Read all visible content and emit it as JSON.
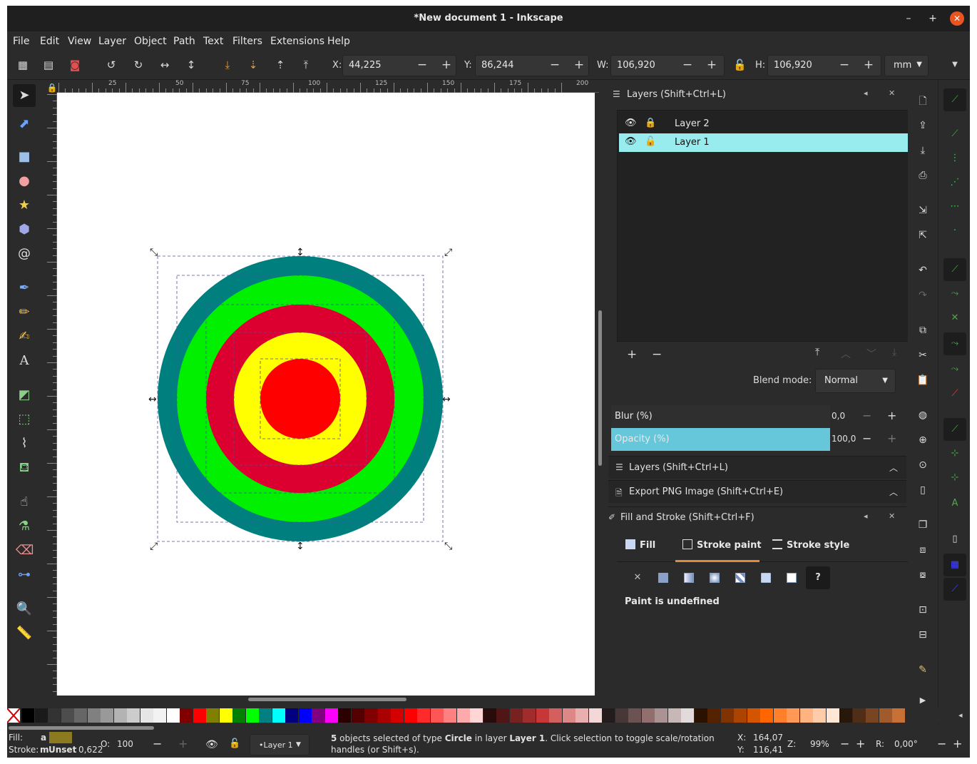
{
  "window": {
    "title": "*New document 1 - Inkscape",
    "min": "–",
    "max": "+",
    "close": "✕"
  },
  "menu": [
    "File",
    "Edit",
    "View",
    "Layer",
    "Object",
    "Path",
    "Text",
    "Filters",
    "Extensions",
    "Help"
  ],
  "toolbar": {
    "x_label": "X:",
    "x_value": "44,225",
    "y_label": "Y:",
    "y_value": "86,244",
    "w_label": "W:",
    "w_value": "106,920",
    "h_label": "H:",
    "h_value": "106,920",
    "unit": "mm"
  },
  "ruler": {
    "top_labels": [
      "25",
      "50",
      "75",
      "100",
      "125",
      "150",
      "175",
      "200"
    ]
  },
  "canvas": {
    "circles": [
      {
        "color": "#007f7f"
      },
      {
        "color": "#00f000"
      },
      {
        "color": "#dc0030"
      },
      {
        "color": "#ffff00"
      },
      {
        "color": "#ff0000"
      }
    ]
  },
  "layers_panel": {
    "title": "Layers (Shift+Ctrl+L)",
    "layers": [
      {
        "name": "Layer 2",
        "selected": false
      },
      {
        "name": "Layer 1",
        "selected": true
      }
    ],
    "blend_label": "Blend mode:",
    "blend_value": "Normal",
    "blur_label": "Blur (%)",
    "blur_value": "0,0",
    "opacity_label": "Opacity (%)",
    "opacity_value": "100,0"
  },
  "collapsed": [
    {
      "title": "Layers (Shift+Ctrl+L)"
    },
    {
      "title": "Export PNG Image (Shift+Ctrl+E)"
    }
  ],
  "fill_stroke": {
    "title": "Fill and Stroke (Shift+Ctrl+F)",
    "tabs": [
      "Fill",
      "Stroke paint",
      "Stroke style"
    ],
    "active_tab": "Stroke paint",
    "paint_note": "Paint is undefined"
  },
  "palette": {
    "colors": [
      "#000000",
      "#1a1a1a",
      "#333333",
      "#4d4d4d",
      "#666666",
      "#808080",
      "#999999",
      "#b3b3b3",
      "#cccccc",
      "#e6e6e6",
      "#f2f2f2",
      "#ffffff",
      "#800000",
      "#ff0000",
      "#808000",
      "#ffff00",
      "#008000",
      "#00ff00",
      "#008080",
      "#00ffff",
      "#000080",
      "#0000ff",
      "#800080",
      "#ff00ff",
      "#2b0000",
      "#550000",
      "#800000",
      "#aa0000",
      "#d40000",
      "#ff0000",
      "#ff2a2a",
      "#ff5555",
      "#ff8080",
      "#ffaaaa",
      "#ffd5d5",
      "#280b0b",
      "#501616",
      "#782121",
      "#a02c2c",
      "#c83737",
      "#d35f5f",
      "#de8787",
      "#e9afaf",
      "#f4d7d7",
      "#241c1c",
      "#483737",
      "#6c5353",
      "#916f6f",
      "#ac9393",
      "#c8b7b7",
      "#e3dbdb",
      "#2b1100",
      "#552200",
      "#803300",
      "#aa4400",
      "#d45500",
      "#ff6600",
      "#ff7f2a",
      "#ff9955",
      "#ffb380",
      "#ffccaa",
      "#ffe6d5",
      "#28170b",
      "#502d16",
      "#784421",
      "#a05a2c",
      "#c87137"
    ]
  },
  "status": {
    "fill_label": "Fill:",
    "fill_a": "a",
    "fill_color": "#8b7a20",
    "stroke_label": "Stroke:",
    "stroke_m": "m",
    "stroke_value": "Unset",
    "stroke_width": "0,622",
    "opacity_label": "O:",
    "opacity_value": "100",
    "layer_value": "•Layer 1",
    "msg_count": "5",
    "msg_1": " objects selected of type ",
    "msg_type": "Circle",
    "msg_2": " in layer ",
    "msg_layer": "Layer 1",
    "msg_3": ". Click selection to toggle scale/rotation",
    "msg_line2": "handles (or Shift+s).",
    "cx_label": "X:",
    "cx_value": "164,07",
    "cy_label": "Y:",
    "cy_value": "116,41",
    "zoom_label": "Z:",
    "zoom_value": "99%",
    "rot_label": "R:",
    "rot_value": "0,00°"
  }
}
